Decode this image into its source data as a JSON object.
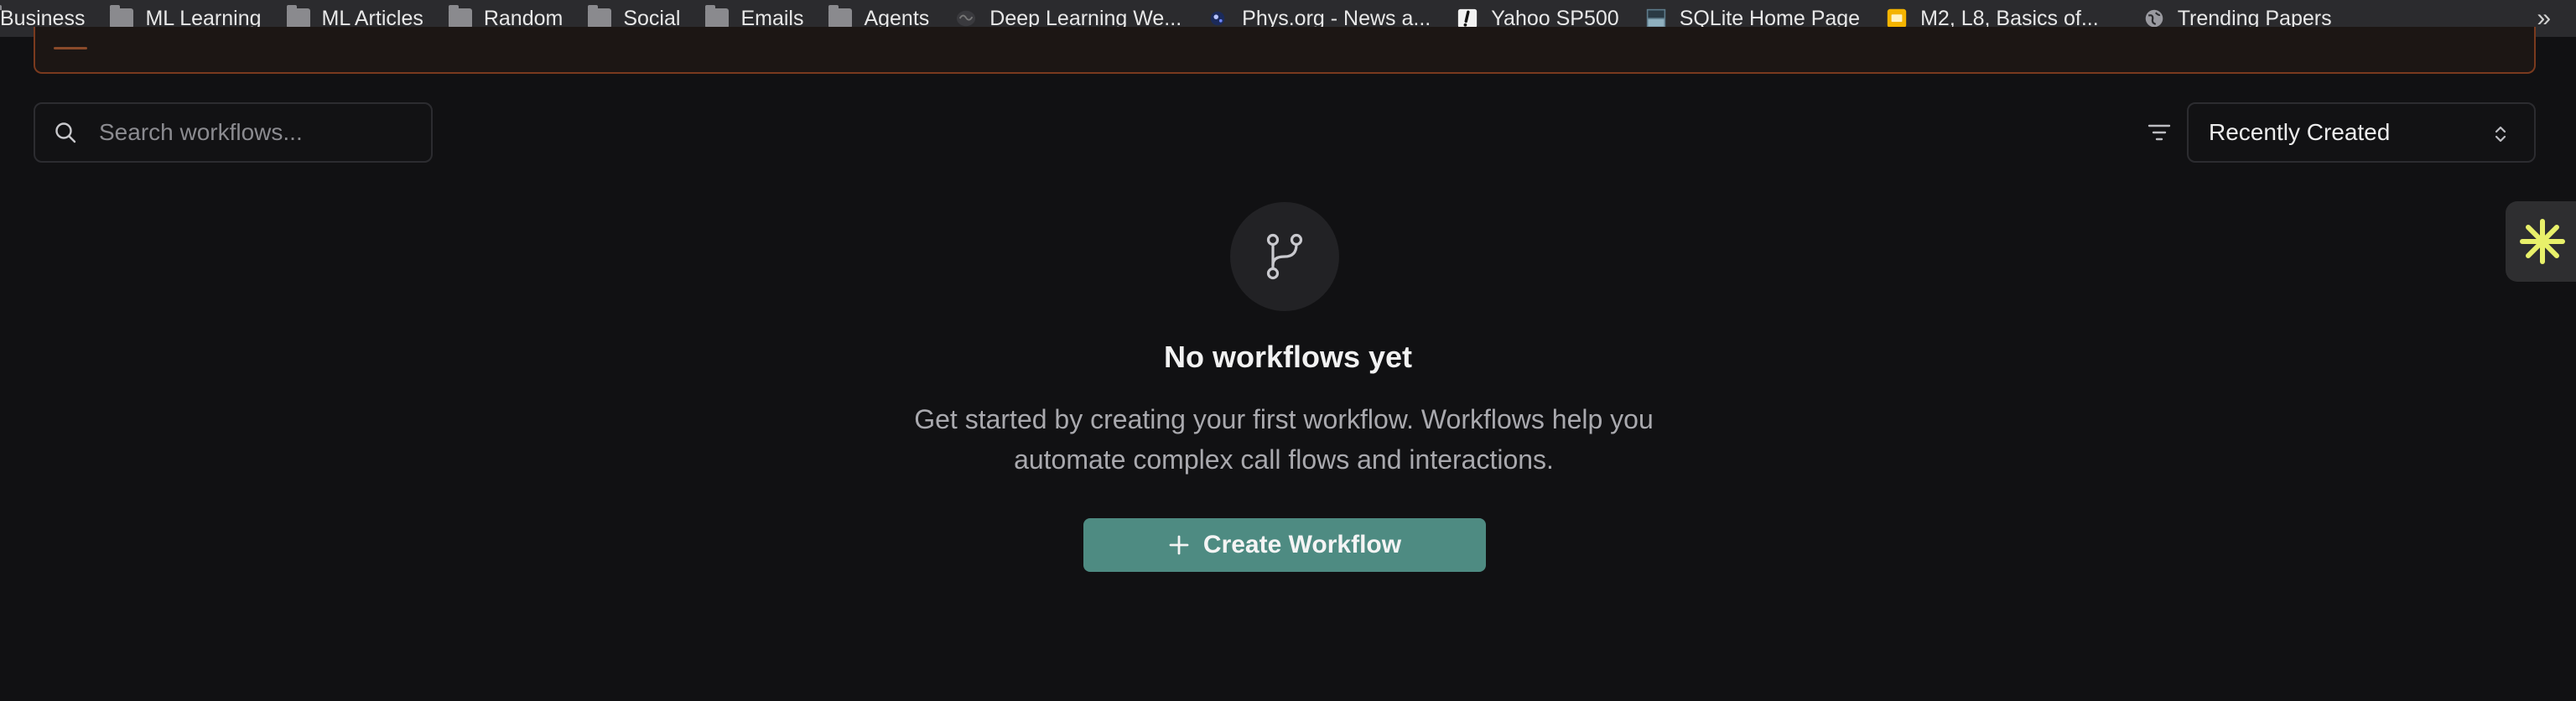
{
  "bookmarks": [
    {
      "label": "Business",
      "icon": "folder-icon"
    },
    {
      "label": "ML Learning",
      "icon": "folder-icon"
    },
    {
      "label": "ML Articles",
      "icon": "folder-icon"
    },
    {
      "label": "Random",
      "icon": "folder-icon"
    },
    {
      "label": "Social",
      "icon": "folder-icon"
    },
    {
      "label": "Emails",
      "icon": "folder-icon"
    },
    {
      "label": "Agents",
      "icon": "folder-icon"
    },
    {
      "label": "Deep Learning We...",
      "icon": "brain-favicon"
    },
    {
      "label": "Phys.org - News a...",
      "icon": "phys-favicon"
    },
    {
      "label": "Yahoo SP500",
      "icon": "yahoo-favicon"
    },
    {
      "label": "SQLite Home Page",
      "icon": "sqlite-favicon"
    },
    {
      "label": "M2, L8, Basics of...",
      "icon": "slides-favicon"
    },
    {
      "label": "Trending Papers",
      "icon": "globe-icon"
    }
  ],
  "bookmarks_more": "»",
  "search": {
    "placeholder": "Search workflows..."
  },
  "sort": {
    "selected": "Recently Created"
  },
  "empty_state": {
    "title": "No workflows yet",
    "description": "Get started by creating your first workflow. Workflows help you automate complex call flows and interactions.",
    "button_label": "Create Workflow",
    "icon": "git-branch-icon"
  },
  "colors": {
    "background": "#111113",
    "accent": "#4e8b82",
    "banner_border": "#7a3a1e",
    "widget_star": "#e8f06a"
  }
}
